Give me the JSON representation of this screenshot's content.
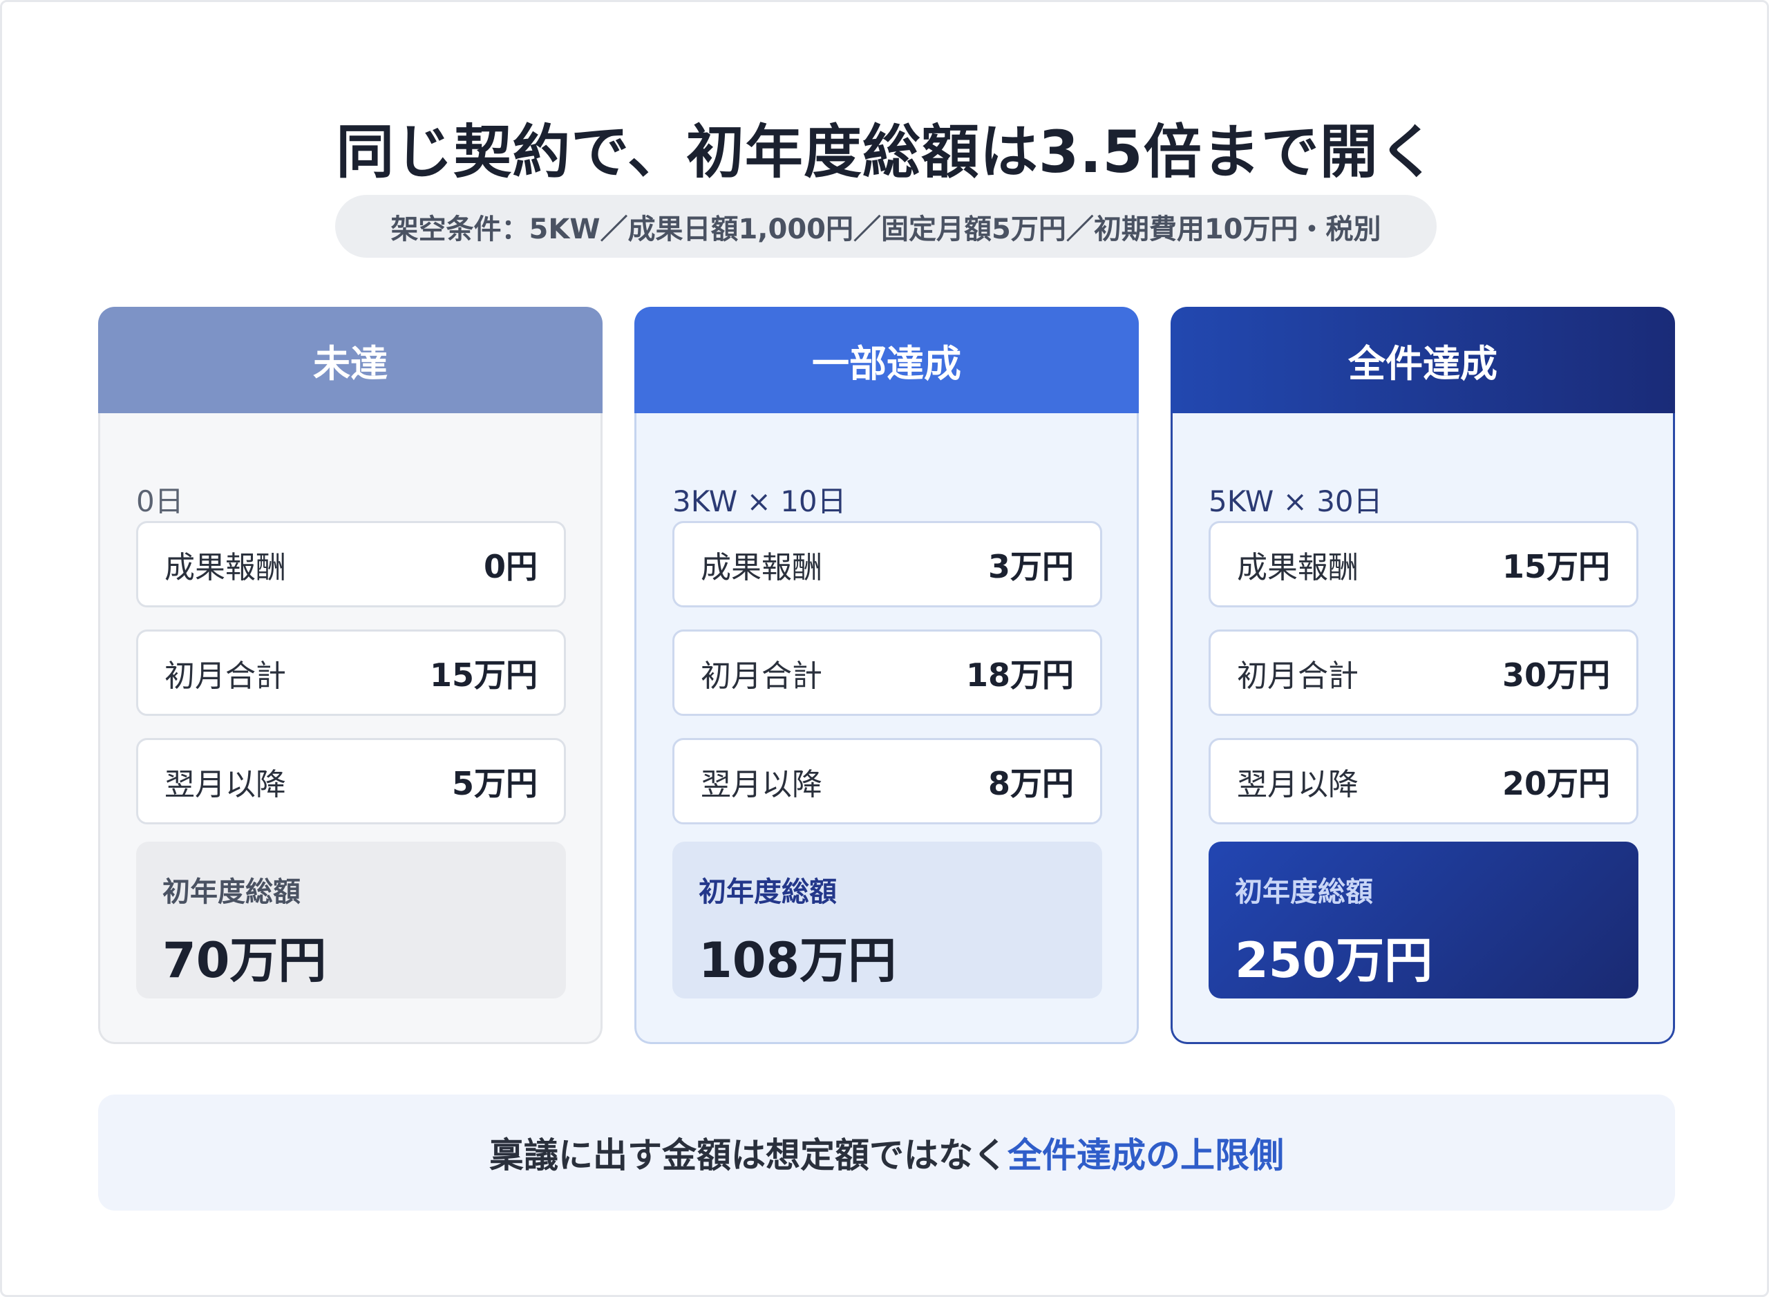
{
  "title": "同じ契約で、初年度総額は3.5倍まで開く",
  "condition": "架空条件：5KW／成果日額1,000円／固定月額5万円／初期費用10万円・税別",
  "cards": [
    {
      "header": "未達",
      "formula": "0日",
      "rows": [
        {
          "label": "成果報酬",
          "value": "0円"
        },
        {
          "label": "初月合計",
          "value": "15万円"
        },
        {
          "label": "翌月以降",
          "value": "5万円"
        }
      ],
      "total_label": "初年度総額",
      "total_value": "70万円"
    },
    {
      "header": "一部達成",
      "formula": "3KW × 10日",
      "rows": [
        {
          "label": "成果報酬",
          "value": "3万円"
        },
        {
          "label": "初月合計",
          "value": "18万円"
        },
        {
          "label": "翌月以降",
          "value": "8万円"
        }
      ],
      "total_label": "初年度総額",
      "total_value": "108万円"
    },
    {
      "header": "全件達成",
      "formula": "5KW × 30日",
      "rows": [
        {
          "label": "成果報酬",
          "value": "15万円"
        },
        {
          "label": "初月合計",
          "value": "30万円"
        },
        {
          "label": "翌月以降",
          "value": "20万円"
        }
      ],
      "total_label": "初年度総額",
      "total_value": "250万円"
    }
  ],
  "note": {
    "plain": "稟議に出す金額は想定額ではなく",
    "accent": "全件達成の上限側"
  },
  "colors": {
    "card1_header": "#7d93c6",
    "card2_header": "#3f6fdf",
    "card3_header": "#1e3a98",
    "accent_text": "#2f5dc9"
  }
}
